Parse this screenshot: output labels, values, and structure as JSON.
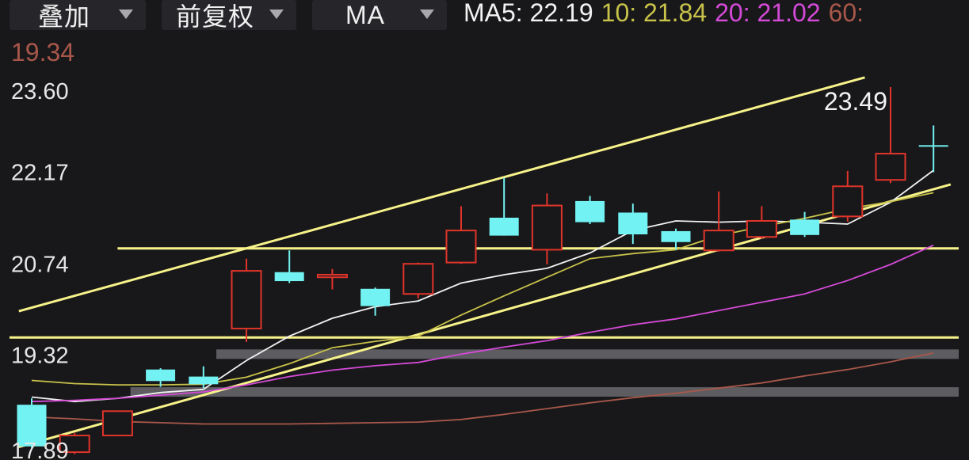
{
  "toolbar": {
    "overlay_label": "叠加",
    "adjust_label": "前复权",
    "indicator_label": "MA"
  },
  "legend": {
    "ma5": "MA5: 22.19",
    "ma10": "10: 21.84",
    "ma20": "20: 21.02",
    "ma60_key": "60:",
    "ma60_value": "19.34"
  },
  "colors": {
    "background": "#18181a",
    "up": "#e0342a",
    "down": "#72f2f2",
    "ma5": "#f2f2f2",
    "ma10": "#c8c24a",
    "ma20": "#d54ad8",
    "ma60": "#a8574a",
    "trendline": "#f7f38a",
    "band": "#6a6a6e"
  },
  "chart_data": {
    "type": "candlestick",
    "ylim": [
      17.89,
      23.6
    ],
    "y_ticks": [
      "23.60",
      "22.17",
      "20.74",
      "19.32",
      "17.89"
    ],
    "max_label": "23.49",
    "candles": [
      {
        "o": 18.53,
        "c": 17.88,
        "h": 18.63,
        "l": 17.86
      },
      {
        "o": 17.79,
        "c": 18.05,
        "h": 18.09,
        "l": 17.76
      },
      {
        "o": 18.05,
        "c": 18.43,
        "h": 18.43,
        "l": 18.05
      },
      {
        "o": 19.08,
        "c": 18.9,
        "h": 19.1,
        "l": 18.81
      },
      {
        "o": 18.97,
        "c": 18.85,
        "h": 19.13,
        "l": 18.79
      },
      {
        "o": 19.72,
        "c": 20.62,
        "h": 20.81,
        "l": 19.51
      },
      {
        "o": 20.6,
        "c": 20.46,
        "h": 20.94,
        "l": 20.43
      },
      {
        "o": 20.52,
        "c": 20.56,
        "h": 20.65,
        "l": 20.33
      },
      {
        "o": 20.34,
        "c": 20.07,
        "h": 20.36,
        "l": 19.92
      },
      {
        "o": 20.26,
        "c": 20.73,
        "h": 20.75,
        "l": 20.19
      },
      {
        "o": 20.75,
        "c": 21.25,
        "h": 21.63,
        "l": 20.73
      },
      {
        "o": 21.45,
        "c": 21.17,
        "h": 22.07,
        "l": 21.17
      },
      {
        "o": 20.95,
        "c": 21.64,
        "h": 21.83,
        "l": 20.72
      },
      {
        "o": 21.71,
        "c": 21.38,
        "h": 21.79,
        "l": 21.35
      },
      {
        "o": 21.53,
        "c": 21.19,
        "h": 21.67,
        "l": 21.04
      },
      {
        "o": 21.24,
        "c": 21.07,
        "h": 21.28,
        "l": 20.95
      },
      {
        "o": 20.94,
        "c": 21.25,
        "h": 21.86,
        "l": 20.92
      },
      {
        "o": 21.15,
        "c": 21.4,
        "h": 21.63,
        "l": 21.12
      },
      {
        "o": 21.42,
        "c": 21.18,
        "h": 21.54,
        "l": 21.15
      },
      {
        "o": 21.47,
        "c": 21.94,
        "h": 22.18,
        "l": 21.39
      },
      {
        "o": 22.04,
        "c": 22.45,
        "h": 23.49,
        "l": 21.99
      },
      {
        "o": 22.57,
        "c": 22.57,
        "h": 22.89,
        "l": 22.16
      }
    ],
    "series": [
      {
        "name": "MA5",
        "values": [
          18.65,
          18.58,
          18.63,
          18.72,
          18.77,
          19.22,
          19.6,
          19.88,
          20.06,
          20.15,
          20.43,
          20.56,
          20.66,
          20.9,
          21.25,
          21.4,
          21.38,
          21.4,
          21.38,
          21.35,
          21.69,
          22.19
        ]
      },
      {
        "name": "10",
        "values": [
          18.91,
          18.86,
          18.84,
          18.84,
          18.85,
          18.96,
          19.17,
          19.42,
          19.52,
          19.6,
          19.93,
          20.23,
          20.52,
          20.81,
          20.89,
          20.95,
          21.17,
          21.31,
          21.44,
          21.59,
          21.7,
          21.84
        ]
      },
      {
        "name": "20",
        "values": [
          18.58,
          18.6,
          18.63,
          18.68,
          18.73,
          18.84,
          18.97,
          19.07,
          19.14,
          19.19,
          19.32,
          19.43,
          19.53,
          19.66,
          19.78,
          19.87,
          20.0,
          20.13,
          20.26,
          20.47,
          20.72,
          21.02
        ]
      },
      {
        "name": "60",
        "values": [
          18.34,
          18.31,
          18.27,
          18.25,
          18.23,
          18.23,
          18.23,
          18.24,
          18.25,
          18.26,
          18.3,
          18.38,
          18.47,
          18.56,
          18.64,
          18.71,
          18.79,
          18.87,
          18.98,
          19.08,
          19.2,
          19.34
        ]
      }
    ],
    "upper_channel": {
      "from": [
        -0.3,
        19.99
      ],
      "to": [
        19.4,
        23.64
      ]
    },
    "lower_channel": {
      "from": [
        -0.3,
        17.87
      ],
      "to": [
        21.4,
        21.97
      ]
    },
    "horizontal_lines": [
      20.97,
      19.58
    ],
    "bands": [
      {
        "from_index": 4.3,
        "level": 19.32
      },
      {
        "from_index": 2.3,
        "level": 18.73
      }
    ]
  }
}
